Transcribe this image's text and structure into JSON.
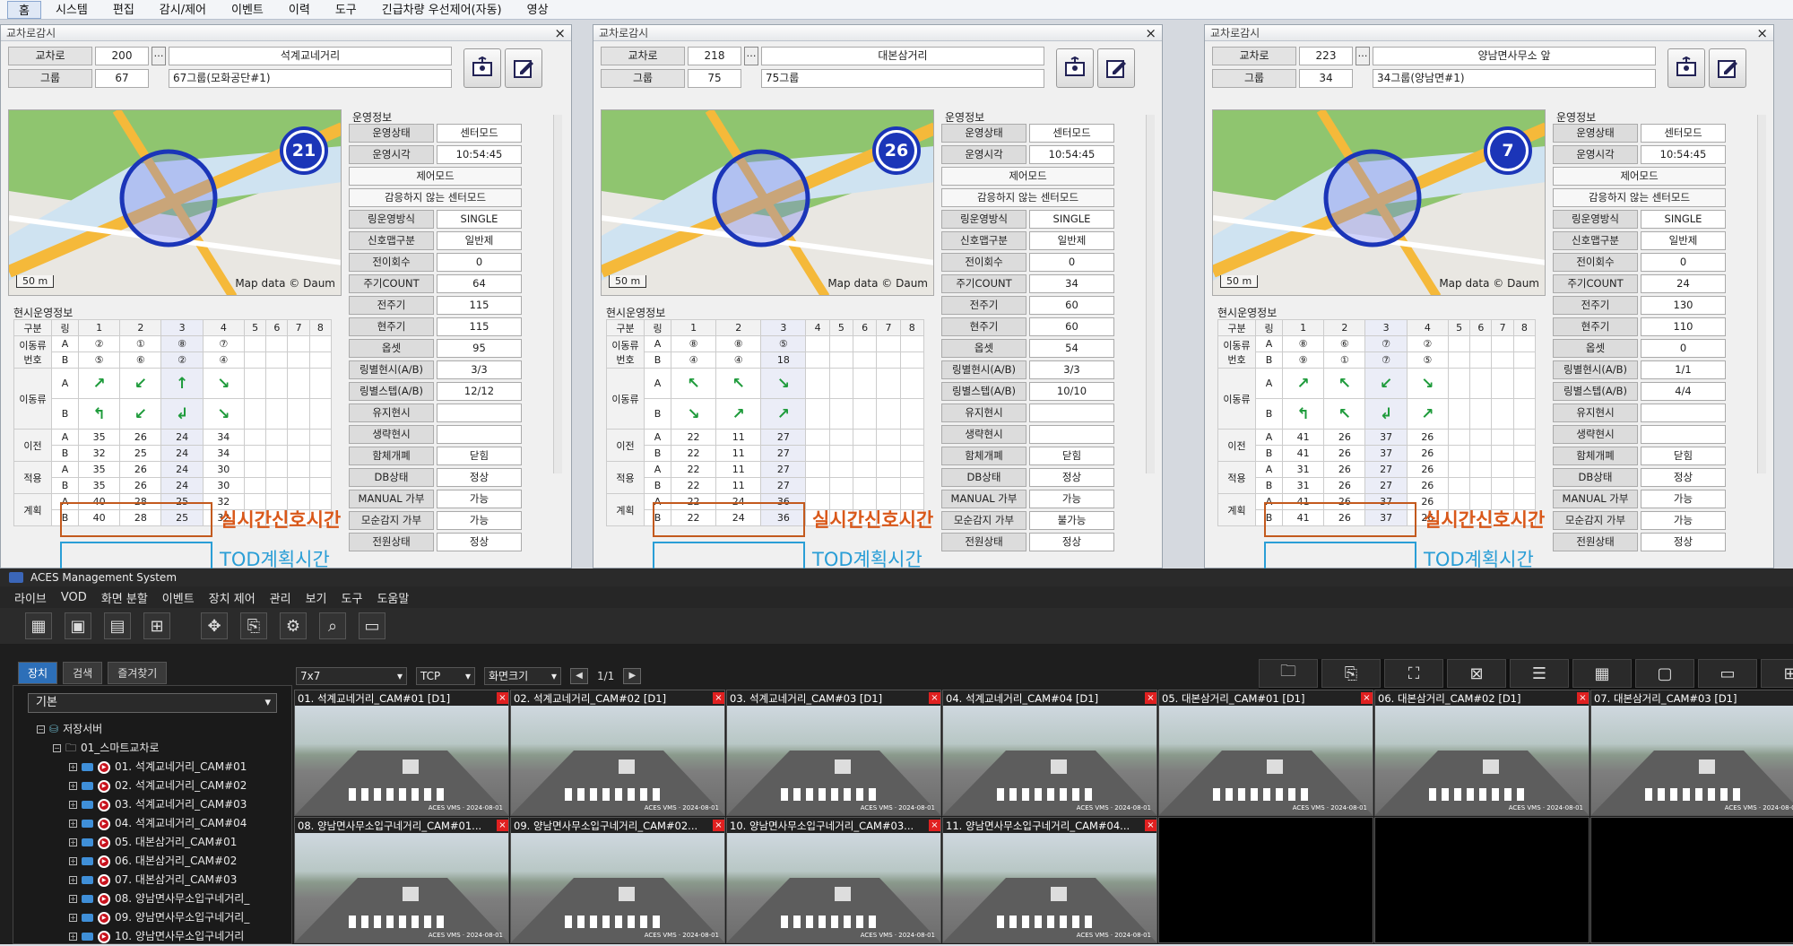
{
  "topmenu": [
    "홈",
    "시스템",
    "편집",
    "감시/제어",
    "이벤트",
    "이력",
    "도구",
    "긴급차량 우선제어(자동)",
    "영상"
  ],
  "panels": [
    {
      "title": "교차로감시",
      "xing_label": "교차로",
      "xing_id": "200",
      "xing_name": "석계교네거리",
      "group_label": "그룹",
      "group_id": "67",
      "group_name": "67그룹(모화공단#1)",
      "badge": "21",
      "map_credit": "Map data © Daum",
      "map_scale": "50 m",
      "op_title": "운영정보",
      "op": [
        [
          "운영상태",
          "센터모드"
        ],
        [
          "운영시각",
          "10:54:45"
        ]
      ],
      "mode": "제어모드",
      "mode_val": "감응하지 않는 센터모드",
      "op2": [
        [
          "링운영방식",
          "SINGLE"
        ],
        [
          "신호맵구분",
          "일반제"
        ],
        [
          "전이회수",
          "0"
        ],
        [
          "주기COUNT",
          "64"
        ],
        [
          "전주기",
          "115"
        ],
        [
          "현주기",
          "115"
        ],
        [
          "옵셋",
          "95"
        ],
        [
          "링별현시(A/B)",
          "3/3"
        ],
        [
          "링별스텝(A/B)",
          "12/12"
        ],
        [
          "유지현시",
          ""
        ],
        [
          "생략현시",
          ""
        ],
        [
          "함체개폐",
          "닫힘"
        ],
        [
          "DB상태",
          "정상"
        ],
        [
          "MANUAL 가부",
          "가능"
        ],
        [
          "모순감지 가부",
          "가능"
        ],
        [
          "전원상태",
          "정상"
        ]
      ],
      "cur_title": "현시운영정보",
      "num_a": [
        "②",
        "①",
        "⑧",
        "⑦"
      ],
      "num_b": [
        "⑤",
        "⑥",
        "②",
        "④"
      ],
      "arr_a": [
        "↗",
        "↙",
        "↑",
        "↘"
      ],
      "arr_b": [
        "↰",
        "↙",
        "↲",
        "↘"
      ],
      "prev_a": [
        "35",
        "26",
        "24",
        "34"
      ],
      "prev_b": [
        "32",
        "25",
        "24",
        "34"
      ],
      "app_a": [
        "35",
        "26",
        "24",
        "30"
      ],
      "app_b": [
        "35",
        "26",
        "24",
        "30"
      ],
      "plan_a": [
        "40",
        "28",
        "25",
        "32"
      ],
      "plan_b": [
        "40",
        "28",
        "25",
        "32"
      ]
    },
    {
      "title": "교차로감시",
      "xing_label": "교차로",
      "xing_id": "218",
      "xing_name": "대본삼거리",
      "group_label": "그룹",
      "group_id": "75",
      "group_name": "75그룹",
      "badge": "26",
      "map_credit": "Map data © Daum",
      "map_scale": "50 m",
      "op_title": "운영정보",
      "op": [
        [
          "운영상태",
          "센터모드"
        ],
        [
          "운영시각",
          "10:54:45"
        ]
      ],
      "mode": "제어모드",
      "mode_val": "감응하지 않는 센터모드",
      "op2": [
        [
          "링운영방식",
          "SINGLE"
        ],
        [
          "신호맵구분",
          "일반제"
        ],
        [
          "전이회수",
          "0"
        ],
        [
          "주기COUNT",
          "34"
        ],
        [
          "전주기",
          "60"
        ],
        [
          "현주기",
          "60"
        ],
        [
          "옵셋",
          "54"
        ],
        [
          "링별현시(A/B)",
          "3/3"
        ],
        [
          "링별스텝(A/B)",
          "10/10"
        ],
        [
          "유지현시",
          ""
        ],
        [
          "생략현시",
          ""
        ],
        [
          "함체개폐",
          "닫힘"
        ],
        [
          "DB상태",
          "정상"
        ],
        [
          "MANUAL 가부",
          "가능"
        ],
        [
          "모순감지 가부",
          "불가능"
        ],
        [
          "전원상태",
          "정상"
        ]
      ],
      "cur_title": "현시운영정보",
      "num_a": [
        "⑧",
        "⑧",
        "⑤",
        ""
      ],
      "num_b": [
        "④",
        "④",
        "18",
        ""
      ],
      "arr_a": [
        "↖",
        "↖",
        "↘",
        ""
      ],
      "arr_b": [
        "↘",
        "↗",
        "↗",
        ""
      ],
      "prev_a": [
        "22",
        "11",
        "27",
        ""
      ],
      "prev_b": [
        "22",
        "11",
        "27",
        ""
      ],
      "app_a": [
        "22",
        "11",
        "27",
        ""
      ],
      "app_b": [
        "22",
        "11",
        "27",
        ""
      ],
      "plan_a": [
        "22",
        "24",
        "36",
        ""
      ],
      "plan_b": [
        "22",
        "24",
        "36",
        ""
      ]
    },
    {
      "title": "교차로감시",
      "xing_label": "교차로",
      "xing_id": "223",
      "xing_name": "양남면사무소 앞",
      "group_label": "그룹",
      "group_id": "34",
      "group_name": "34그룹(양남면#1)",
      "badge": "7",
      "map_credit": "Map data © Daum",
      "map_scale": "50 m",
      "op_title": "운영정보",
      "op": [
        [
          "운영상태",
          "센터모드"
        ],
        [
          "운영시각",
          "10:54:45"
        ]
      ],
      "mode": "제어모드",
      "mode_val": "감응하지 않는 센터모드",
      "op2": [
        [
          "링운영방식",
          "SINGLE"
        ],
        [
          "신호맵구분",
          "일반제"
        ],
        [
          "전이회수",
          "0"
        ],
        [
          "주기COUNT",
          "24"
        ],
        [
          "전주기",
          "130"
        ],
        [
          "현주기",
          "110"
        ],
        [
          "옵셋",
          "0"
        ],
        [
          "링별현시(A/B)",
          "1/1"
        ],
        [
          "링별스텝(A/B)",
          "4/4"
        ],
        [
          "유지현시",
          ""
        ],
        [
          "생략현시",
          ""
        ],
        [
          "함체개폐",
          "닫힘"
        ],
        [
          "DB상태",
          "정상"
        ],
        [
          "MANUAL 가부",
          "가능"
        ],
        [
          "모순감지 가부",
          "가능"
        ],
        [
          "전원상태",
          "정상"
        ]
      ],
      "cur_title": "현시운영정보",
      "num_a": [
        "⑧",
        "⑥",
        "⑦",
        "②"
      ],
      "num_b": [
        "⑨",
        "①",
        "⑦",
        "⑤"
      ],
      "arr_a": [
        "↗",
        "↖",
        "↙",
        "↘"
      ],
      "arr_b": [
        "↰",
        "↖",
        "↲",
        "↗"
      ],
      "prev_a": [
        "41",
        "26",
        "37",
        "26"
      ],
      "prev_b": [
        "41",
        "26",
        "37",
        "26"
      ],
      "app_a": [
        "31",
        "26",
        "27",
        "26"
      ],
      "app_b": [
        "31",
        "26",
        "27",
        "26"
      ],
      "plan_a": [
        "41",
        "26",
        "37",
        "26"
      ],
      "plan_b": [
        "41",
        "26",
        "37",
        "26"
      ]
    }
  ],
  "grid_labels": {
    "gubun": "구분",
    "ring": "링",
    "cols": [
      "1",
      "2",
      "3",
      "4",
      "5",
      "6",
      "7",
      "8"
    ],
    "num": "이동류 번호",
    "flow": "이동류",
    "prev": "이전",
    "apply": "적용",
    "plan": "계획",
    "a": "A",
    "b": "B"
  },
  "ann": {
    "realtime": "실시간신호시간",
    "tod": "TOD계획시간"
  },
  "aces": {
    "title": "ACES Management System",
    "menu": [
      "라이브",
      "VOD",
      "화면 분할",
      "이벤트",
      "장치 제어",
      "관리",
      "보기",
      "도구",
      "도움말"
    ],
    "tabs": [
      "장치",
      "검색",
      "즐겨찾기"
    ],
    "tree_select": "기본",
    "tree_root": "저장서버",
    "tree_group": "01_스마트교차로",
    "tree_items": [
      "01. 석계교네거리_CAM#01",
      "02. 석계교네거리_CAM#02",
      "03. 석계교네거리_CAM#03",
      "04. 석계교네거리_CAM#04",
      "05. 대본삼거리_CAM#01",
      "06. 대본삼거리_CAM#02",
      "07. 대본삼거리_CAM#03",
      "08. 양남면사무소입구네거리_",
      "09. 양남면사무소입구네거리_",
      "10. 양남면사무소입구네거리"
    ],
    "layout": "7x7",
    "proto": "TCP",
    "screen": "화면크기",
    "page": "1/1",
    "cams": [
      "01. 석계교네거리_CAM#01 [D1]",
      "02. 석계교네거리_CAM#02 [D1]",
      "03. 석계교네거리_CAM#03 [D1]",
      "04. 석계교네거리_CAM#04 [D1]",
      "05. 대본삼거리_CAM#01 [D1]",
      "06. 대본삼거리_CAM#02 [D1]",
      "07. 대본삼거리_CAM#03 [D1]",
      "08. 양남면사무소입구네거리_CAM#01...",
      "09. 양남면사무소입구네거리_CAM#02...",
      "10. 양남면사무소입구네거리_CAM#03...",
      "11. 양남면사무소입구네거리_CAM#04..."
    ],
    "stamp": "ACES VMS · 2024-08-01"
  },
  "bg": {
    "map_green": "#8fc56f",
    "road": "#f5b93a",
    "circle": "#1b35b8"
  }
}
